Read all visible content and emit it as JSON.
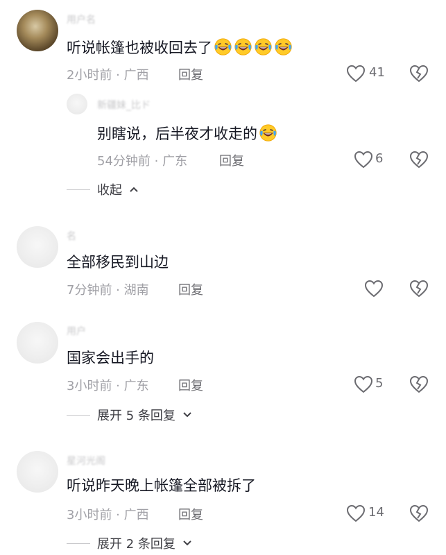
{
  "comments": [
    {
      "text": "听说帐篷也被收回去了",
      "emoji_count": 4,
      "time": "2小时前 · 广西",
      "reply_label": "回复",
      "likes": "41",
      "replies": [
        {
          "text": "别瞎说，后半夜才收走的",
          "emoji_count": 1,
          "time": "54分钟前 · 广东",
          "reply_label": "回复",
          "likes": "6"
        }
      ],
      "thread_toggle": "收起"
    },
    {
      "text": "全部移民到山边",
      "time": "7分钟前 · 湖南",
      "reply_label": "回复",
      "likes": ""
    },
    {
      "text": "国家会出手的",
      "time": "3小时前 · 广东",
      "reply_label": "回复",
      "likes": "5",
      "thread_toggle": "展开 5 条回复"
    },
    {
      "text": "听说昨天晚上帐篷全部被拆了",
      "time": "3小时前 · 广西",
      "reply_label": "回复",
      "likes": "14",
      "thread_toggle": "展开 2 条回复"
    }
  ],
  "icons": {
    "like": "heart-outline-icon",
    "dislike": "broken-heart-icon",
    "emoji": "laughing-crying-face-emoji",
    "collapse": "chevron-up-icon",
    "expand": "chevron-down-icon"
  }
}
